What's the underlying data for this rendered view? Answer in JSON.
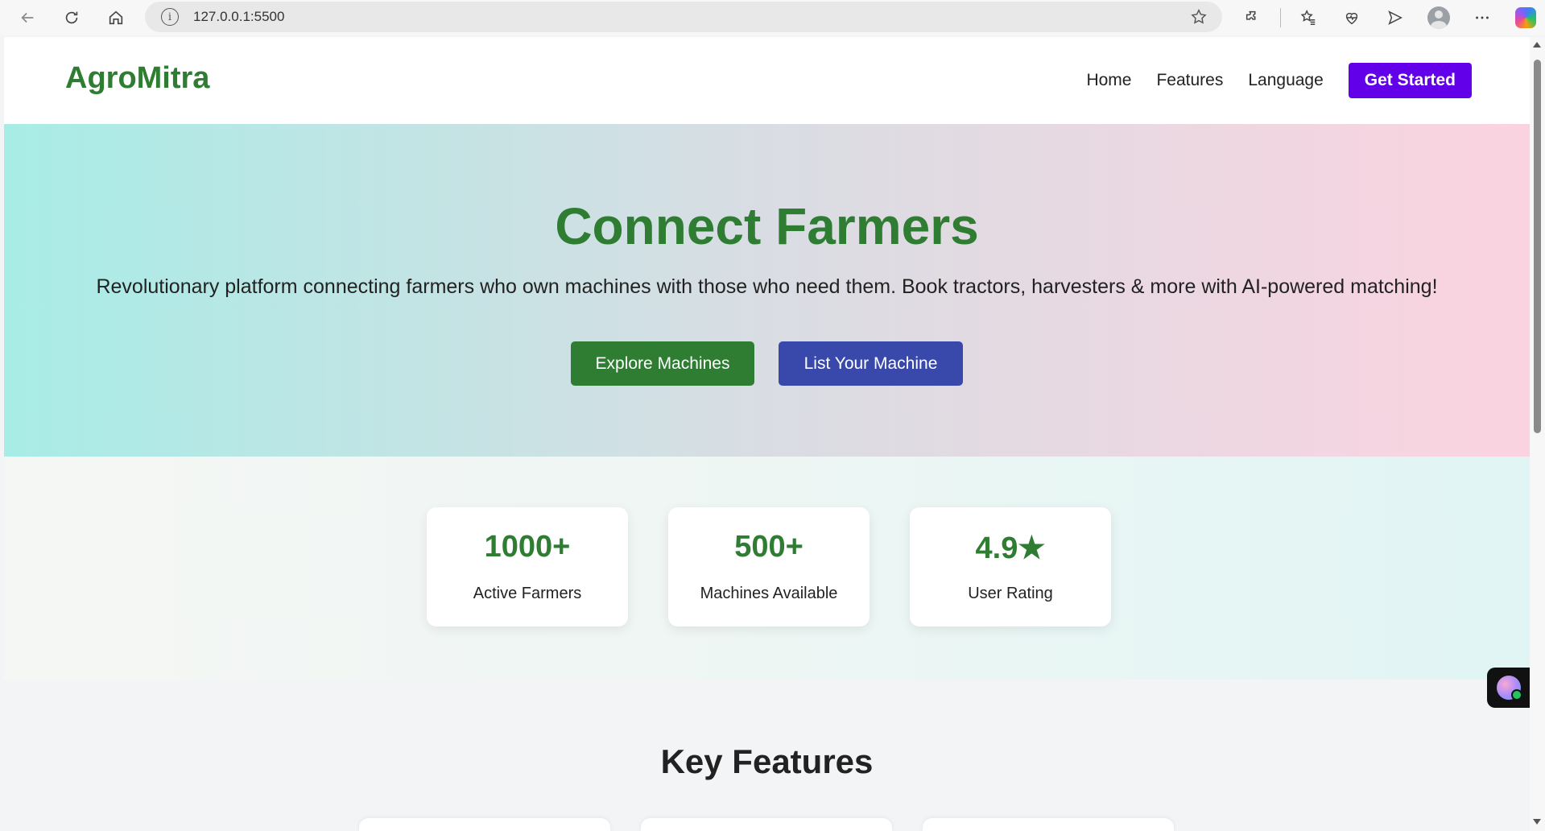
{
  "browser": {
    "url": "127.0.0.1:5500"
  },
  "header": {
    "logo": "AgroMitra",
    "nav": [
      "Home",
      "Features",
      "Language"
    ],
    "cta": "Get Started"
  },
  "hero": {
    "title": "Connect Farmers",
    "subtitle": "Revolutionary platform connecting farmers who own machines with those who need them. Book tractors, harvesters & more with AI-powered matching!",
    "primary_button": "Explore Machines",
    "secondary_button": "List Your Machine"
  },
  "stats": [
    {
      "value": "1000+",
      "label": "Active Farmers"
    },
    {
      "value": "500+",
      "label": "Machines Available"
    },
    {
      "value": "4.9★",
      "label": "User Rating"
    }
  ],
  "features": {
    "title": "Key Features"
  },
  "colors": {
    "brand_green": "#2e7d32",
    "cta_purple": "#6200ea",
    "secondary_blue": "#3949ab"
  }
}
